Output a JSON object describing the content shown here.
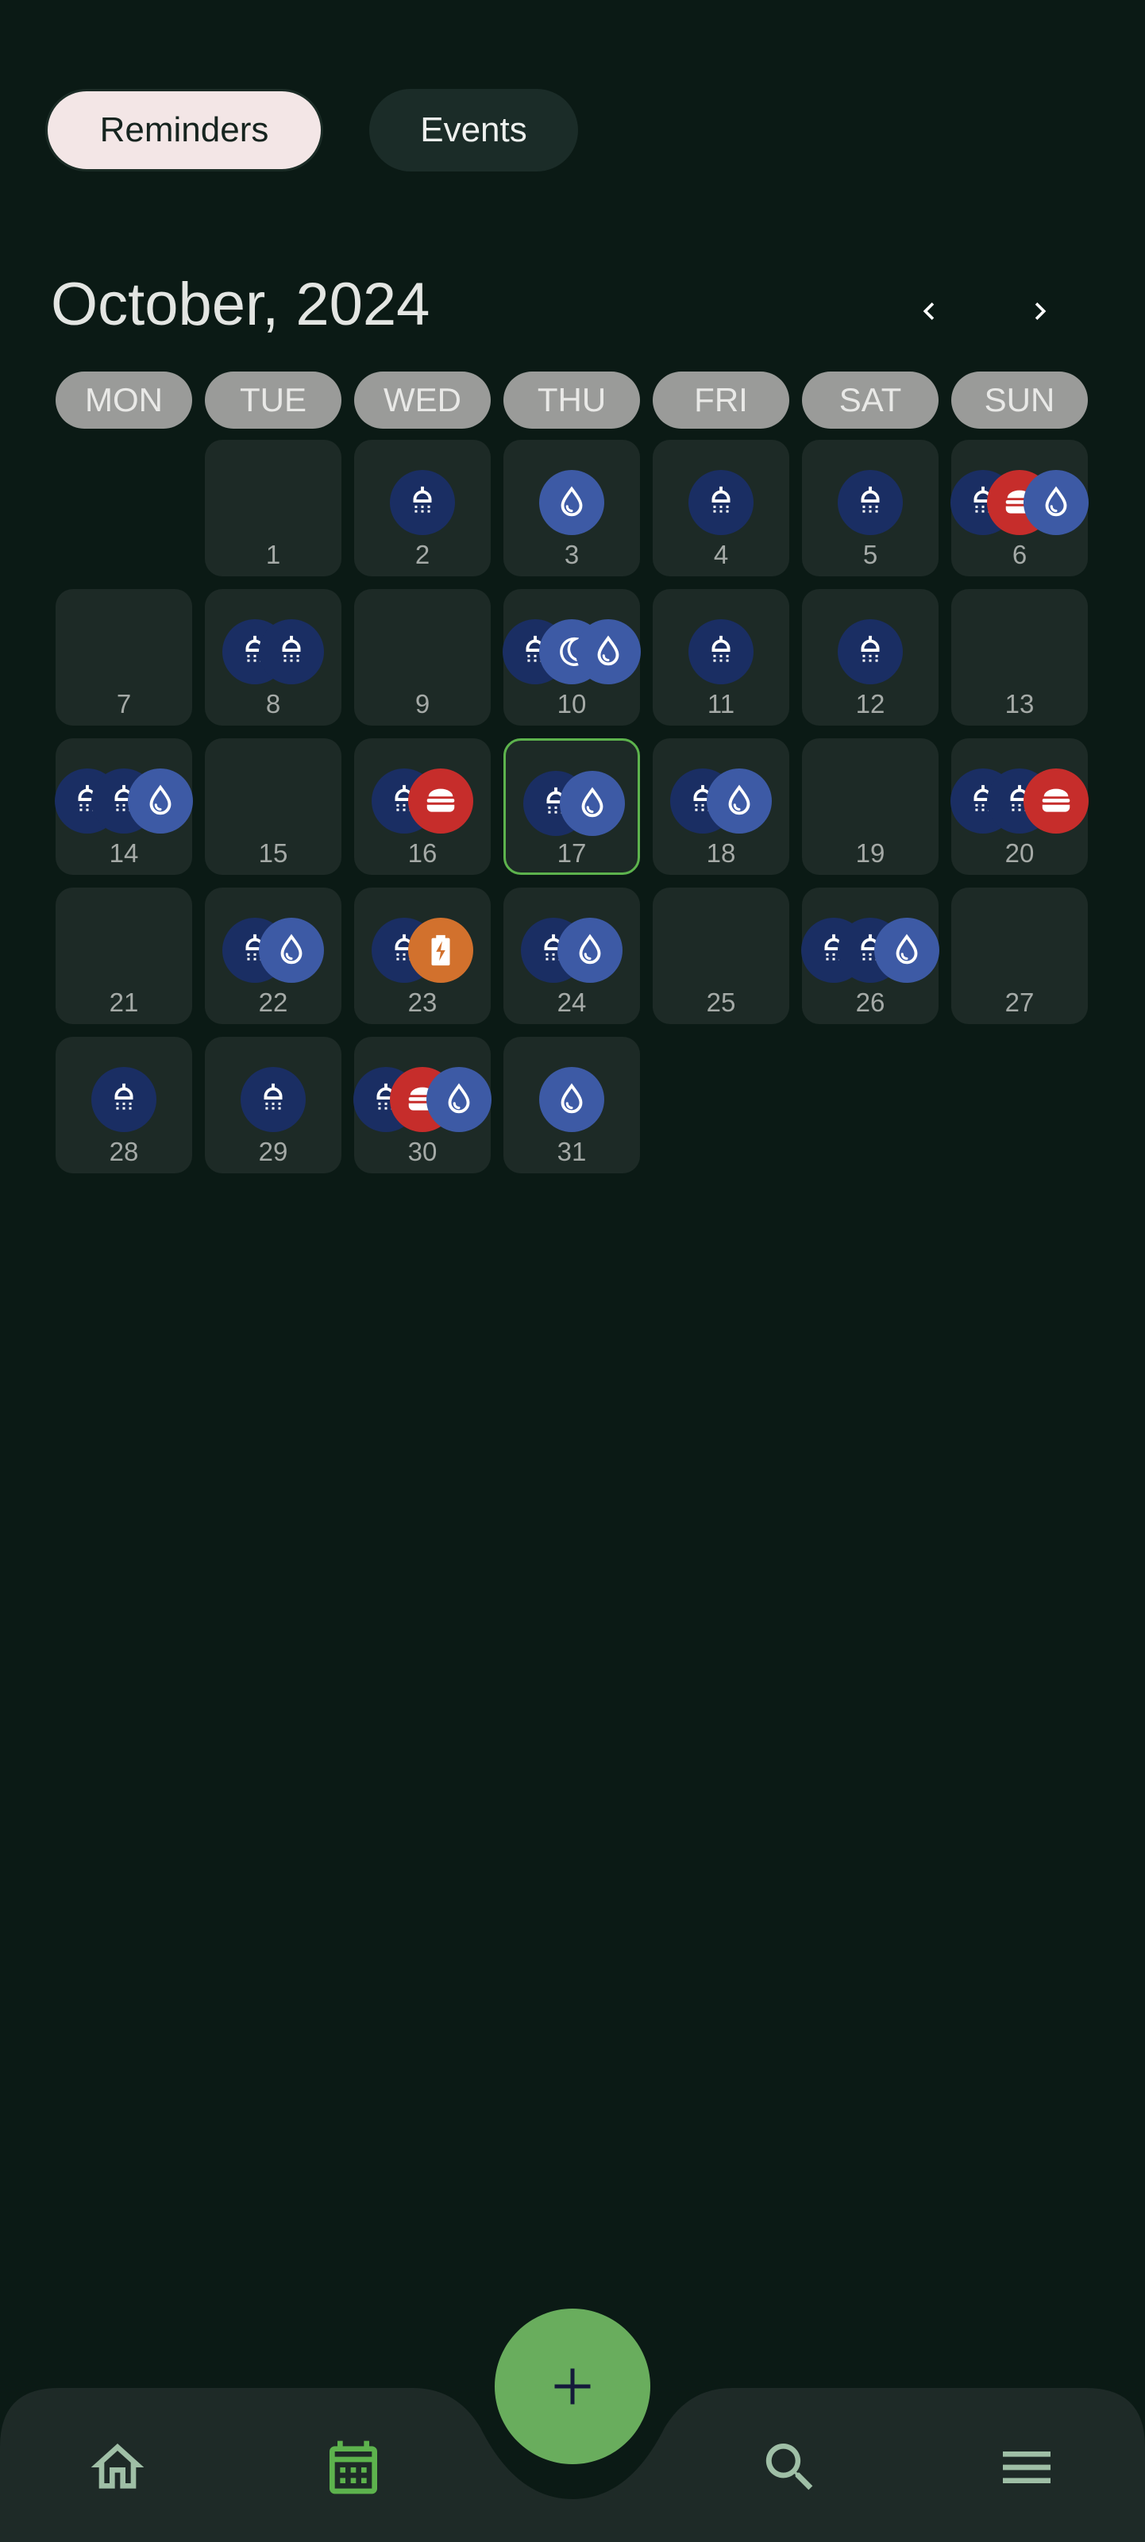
{
  "tabs": {
    "reminders": "Reminders",
    "events": "Events"
  },
  "month_title": "October, 2024",
  "weekdays": [
    "MON",
    "TUE",
    "WED",
    "THU",
    "FRI",
    "SAT",
    "SUN"
  ],
  "today": 17,
  "days": [
    {
      "n": "1",
      "icons": []
    },
    {
      "n": "2",
      "icons": [
        "shower"
      ]
    },
    {
      "n": "3",
      "icons": [
        "drop"
      ]
    },
    {
      "n": "4",
      "icons": [
        "shower"
      ]
    },
    {
      "n": "5",
      "icons": [
        "shower"
      ]
    },
    {
      "n": "6",
      "icons": [
        "shower",
        "food",
        "drop"
      ]
    },
    {
      "n": "7",
      "icons": []
    },
    {
      "n": "8",
      "icons": [
        "shower",
        "shower"
      ]
    },
    {
      "n": "9",
      "icons": []
    },
    {
      "n": "10",
      "icons": [
        "shower",
        "moon",
        "drop"
      ]
    },
    {
      "n": "11",
      "icons": [
        "shower"
      ]
    },
    {
      "n": "12",
      "icons": [
        "shower"
      ]
    },
    {
      "n": "13",
      "icons": []
    },
    {
      "n": "14",
      "icons": [
        "shower",
        "shower",
        "drop"
      ]
    },
    {
      "n": "15",
      "icons": []
    },
    {
      "n": "16",
      "icons": [
        "shower",
        "food"
      ]
    },
    {
      "n": "17",
      "icons": [
        "shower",
        "drop"
      ]
    },
    {
      "n": "18",
      "icons": [
        "shower",
        "drop"
      ]
    },
    {
      "n": "19",
      "icons": []
    },
    {
      "n": "20",
      "icons": [
        "shower",
        "shower",
        "food"
      ]
    },
    {
      "n": "21",
      "icons": []
    },
    {
      "n": "22",
      "icons": [
        "shower",
        "drop"
      ]
    },
    {
      "n": "23",
      "icons": [
        "shower",
        "battery"
      ]
    },
    {
      "n": "24",
      "icons": [
        "shower",
        "drop"
      ]
    },
    {
      "n": "25",
      "icons": []
    },
    {
      "n": "26",
      "icons": [
        "shower",
        "shower",
        "drop"
      ]
    },
    {
      "n": "27",
      "icons": []
    },
    {
      "n": "28",
      "icons": [
        "shower"
      ]
    },
    {
      "n": "29",
      "icons": [
        "shower"
      ]
    },
    {
      "n": "30",
      "icons": [
        "shower",
        "food",
        "drop"
      ]
    },
    {
      "n": "31",
      "icons": [
        "drop"
      ]
    }
  ],
  "icon_names": {
    "shower": "shower-icon",
    "drop": "water-drop-icon",
    "food": "burger-icon",
    "moon": "moon-icon",
    "battery": "battery-charging-icon"
  },
  "nav": {
    "items": [
      "home-icon",
      "calendar-icon",
      "search-icon",
      "menu-icon"
    ],
    "active": "calendar-icon",
    "fab": "plus-icon"
  },
  "colors": {
    "background": "#0b1a15",
    "accent": "#5db34d",
    "fab": "#69ad5d",
    "shower": "#1a2e63",
    "drop": "#3d5aa5",
    "food": "#c62d2b",
    "battery": "#d2712d"
  }
}
